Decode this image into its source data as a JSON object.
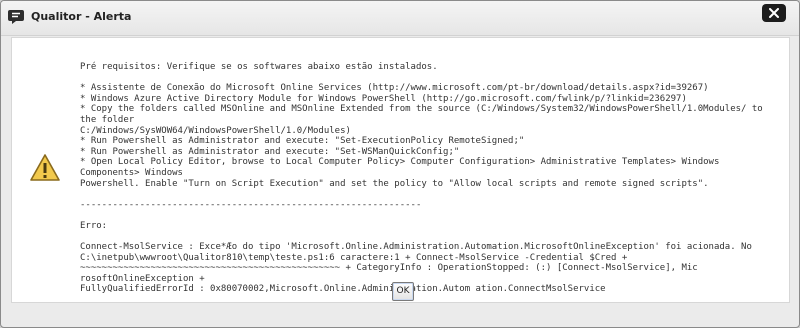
{
  "window": {
    "title": "Qualitor - Alerta",
    "icon": "chat-bubble-icon",
    "close_icon": "close-icon"
  },
  "message": {
    "icon": "warning-icon",
    "text": "Pré requisitos: Verifique se os softwares abaixo estão instalados.\n\n* Assistente de Conexão do Microsoft Online Services (http://www.microsoft.com/pt-br/download/details.aspx?id=39267)\n* Windows Azure Active Directory Module for Windows PowerShell (http://go.microsoft.com/fwlink/p/?linkid=236297)\n* Copy the folders called MSOnline and MSOnline Extended from the source (C:/Windows/System32/WindowsPowerShell/1.0Modules/ to the folder\nC:/Windows/SysWOW64/WindowsPowerShell/1.0/Modules)\n* Run Powershell as Administrator and execute: \"Set-ExecutionPolicy RemoteSigned;\"\n* Run Powershell as Administrator and execute: \"Set-WSManQuickConfig;\"\n* Open Local Policy Editor, browse to Local Computer Policy> Computer Configuration> Administrative Templates> Windows Components> Windows\nPowershell. Enable \"Turn on Script Execution\" and set the policy to \"Allow local scripts and remote signed scripts\".\n\n---------------------------------------------------------------\n\nErro:\n\nConnect-MsolService : Exce*Æo do tipo 'Microsoft.Online.Administration.Automation.MicrosoftOnlineException' foi acionada. No\nC:\\inetpub\\wwwroot\\Qualitor810\\temp\\teste.ps1:6 caractere:1 + Connect-MsolService -Credential $Cred +\n~~~~~~~~~~~~~~~~~~~~~~~~~~~~~~~~~~~~~~~~~~~~~~~~ + CategoryInfo : OperationStopped: (:) [Connect-MsolService], Mic rosoftOnlineException +\nFullyQualifiedErrorId : 0x80070002,Microsoft.Online.Administration.Autom ation.ConnectMsolService"
  },
  "buttons": {
    "ok_label": "OK"
  },
  "colors": {
    "close_button": "#1d1d1d",
    "warning_fill": "#f2c94c",
    "warning_stroke": "#8a6a1c"
  }
}
